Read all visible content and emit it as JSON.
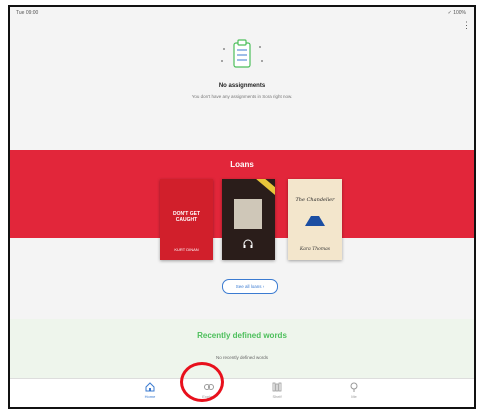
{
  "status": {
    "time": "Tue 09:00",
    "right": "✓ 100%"
  },
  "empty_state": {
    "title": "No assignments",
    "subtitle": "You don't have any assignments in Sora right now."
  },
  "loans": {
    "title": "Loans",
    "books": [
      {
        "title": "DON'T GET CAUGHT",
        "author": "KURT DINAN",
        "color": "#d11f2b"
      },
      {
        "title": "Audiobook",
        "color": "#2a1d1a"
      },
      {
        "title": "The Chandelier",
        "author": "Kara Thomas",
        "color": "#f3e6cc"
      }
    ],
    "see_all": "See all loans  ›"
  },
  "words": {
    "title": "Recently defined words",
    "subtitle": "No recently defined words"
  },
  "tabs": [
    {
      "label": "Home",
      "icon": "home-icon",
      "active": true
    },
    {
      "label": "Explore",
      "icon": "explore-icon"
    },
    {
      "label": "Shelf",
      "icon": "shelf-icon"
    },
    {
      "label": "Me",
      "icon": "me-icon"
    }
  ],
  "colors": {
    "loans_band": "#e2263a",
    "accent_blue": "#3b7bd1",
    "green_title": "#4cbf5b",
    "highlight": "#e8101c"
  }
}
